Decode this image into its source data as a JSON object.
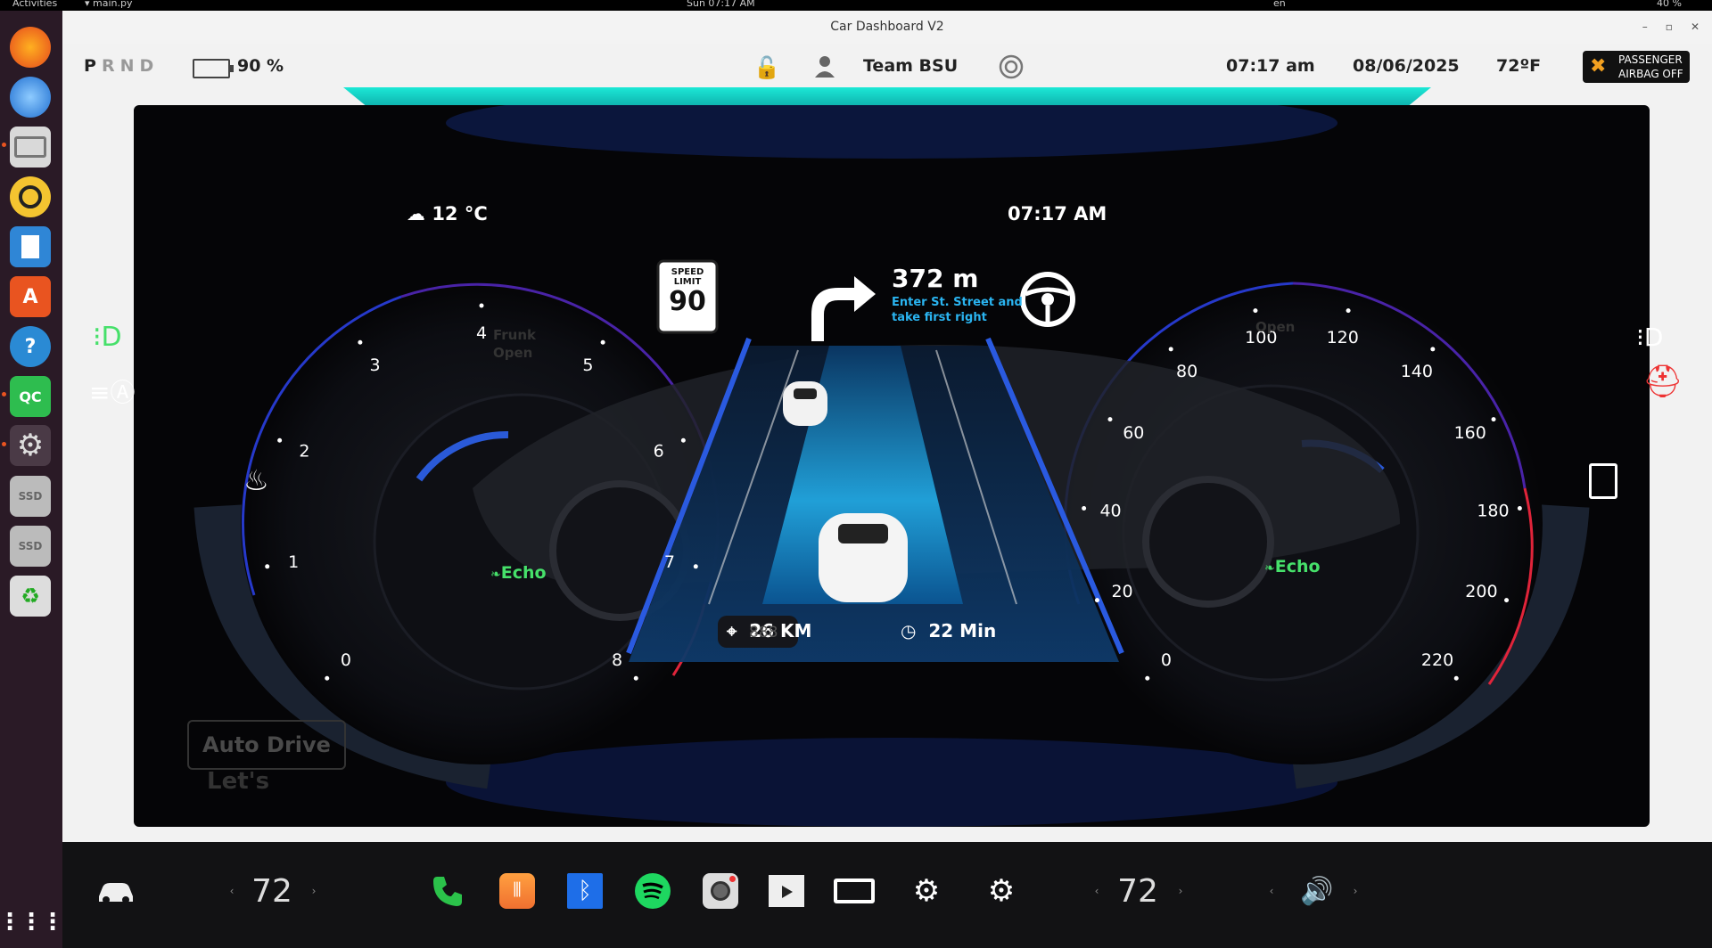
{
  "os": {
    "activities": "Activities",
    "app_menu": "main.py",
    "clock": "Sun 07:17 AM",
    "lang": "en",
    "battery": "40 %"
  },
  "window": {
    "title": "Car Dashboard V2"
  },
  "status": {
    "gear": [
      "P",
      "R",
      "N",
      "D"
    ],
    "battery_pct": "90 %",
    "user": "Team BSU",
    "time": "07:17 am",
    "date": "08/06/2025",
    "temp_out": "72ºF",
    "airbag_line1": "PASSENGER",
    "airbag_line2": "AIRBAG OFF"
  },
  "cluster": {
    "weather": "12 °C",
    "clock": "07:17 AM",
    "speed_limit_label1": "SPEED",
    "speed_limit_label2": "LIMIT",
    "speed_limit": "90",
    "nav_distance": "372 m",
    "nav_instruction1": "Enter St. Street and",
    "nav_instruction2": "take first right",
    "trip_distance": "26 KM",
    "trip_time": "22 Min",
    "odometer": "888",
    "mode_left": "Echo",
    "mode_right": "Echo",
    "frunk": "Frunk",
    "frunk_state": "Open",
    "trunk_state": "Open",
    "rpm_ticks": [
      "0",
      "1",
      "2",
      "3",
      "4",
      "5",
      "6",
      "7",
      "8"
    ],
    "speed_ticks": [
      "0",
      "20",
      "40",
      "60",
      "80",
      "100",
      "120",
      "140",
      "160",
      "180",
      "200",
      "220"
    ],
    "auto_drive": "Auto Drive",
    "lets": "Let's"
  },
  "bottom": {
    "left_temp": "72",
    "right_temp": "72"
  },
  "colors": {
    "accent_teal": "#19d8cc",
    "road_blue": "#2aa8e8",
    "echo_green": "#46e06a",
    "warning_red": "#e33"
  }
}
